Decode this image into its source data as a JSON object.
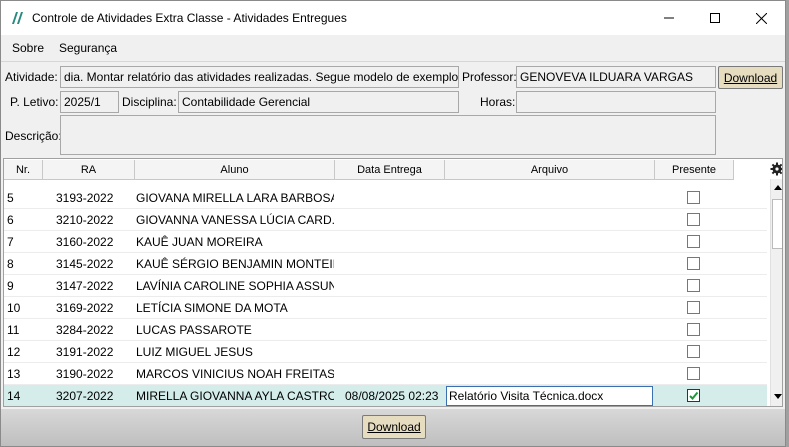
{
  "window": {
    "title": "Controle de Atividades Extra Classe - Atividades Entregues"
  },
  "menu": {
    "items": [
      "Sobre",
      "Segurança"
    ]
  },
  "form": {
    "atividade_label": "Atividade:",
    "atividade_value": "dia. Montar relatório das atividades realizadas.  Segue modelo de exemplo.",
    "professor_label": "Professor:",
    "professor_value": "GENOVEVA ILDUARA VARGAS",
    "download_label": "Download",
    "periodo_label": "P. Letivo:",
    "periodo_value": "2025/1",
    "disciplina_label": "Disciplina:",
    "disciplina_value": "Contabilidade Gerencial",
    "horas_label": "Horas:",
    "horas_value": "",
    "descricao_label": "Descrição:",
    "descricao_value": ""
  },
  "grid": {
    "columns": [
      "Nr.",
      "RA",
      "Aluno",
      "Data Entrega",
      "Arquivo",
      "Presente"
    ],
    "rows": [
      {
        "nr": "5",
        "ra": "3193-2022",
        "aluno": "GIOVANA MIRELLA LARA BARBOSA",
        "data": "",
        "arquivo": "",
        "presente": false
      },
      {
        "nr": "6",
        "ra": "3210-2022",
        "aluno": "GIOVANNA VANESSA LÚCIA CARD...",
        "data": "",
        "arquivo": "",
        "presente": false
      },
      {
        "nr": "7",
        "ra": "3160-2022",
        "aluno": "KAUÊ JUAN MOREIRA",
        "data": "",
        "arquivo": "",
        "presente": false
      },
      {
        "nr": "8",
        "ra": "3145-2022",
        "aluno": "KAUÊ SÉRGIO BENJAMIN MONTEIRO",
        "data": "",
        "arquivo": "",
        "presente": false
      },
      {
        "nr": "9",
        "ra": "3147-2022",
        "aluno": "LAVÍNIA CAROLINE SOPHIA ASSUN...",
        "data": "",
        "arquivo": "",
        "presente": false
      },
      {
        "nr": "10",
        "ra": "3169-2022",
        "aluno": "LETÍCIA SIMONE DA MOTA",
        "data": "",
        "arquivo": "",
        "presente": false
      },
      {
        "nr": "11",
        "ra": "3284-2022",
        "aluno": "LUCAS PASSAROTE",
        "data": "",
        "arquivo": "",
        "presente": false
      },
      {
        "nr": "12",
        "ra": "3191-2022",
        "aluno": "LUIZ MIGUEL JESUS",
        "data": "",
        "arquivo": "",
        "presente": false
      },
      {
        "nr": "13",
        "ra": "3190-2022",
        "aluno": "MARCOS VINICIUS NOAH FREITAS",
        "data": "",
        "arquivo": "",
        "presente": false
      },
      {
        "nr": "14",
        "ra": "3207-2022",
        "aluno": "MIRELLA GIOVANNA AYLA CASTRO",
        "data": "08/08/2025 02:23",
        "arquivo": "Relatório Visita Técnica.docx",
        "presente": true
      }
    ],
    "selected_row": "14"
  },
  "footer": {
    "download_label": "Download"
  },
  "colors": {
    "selected_row": "#d4edea",
    "button": "#e6dcc0",
    "window_bg": "#f0f0f0"
  }
}
